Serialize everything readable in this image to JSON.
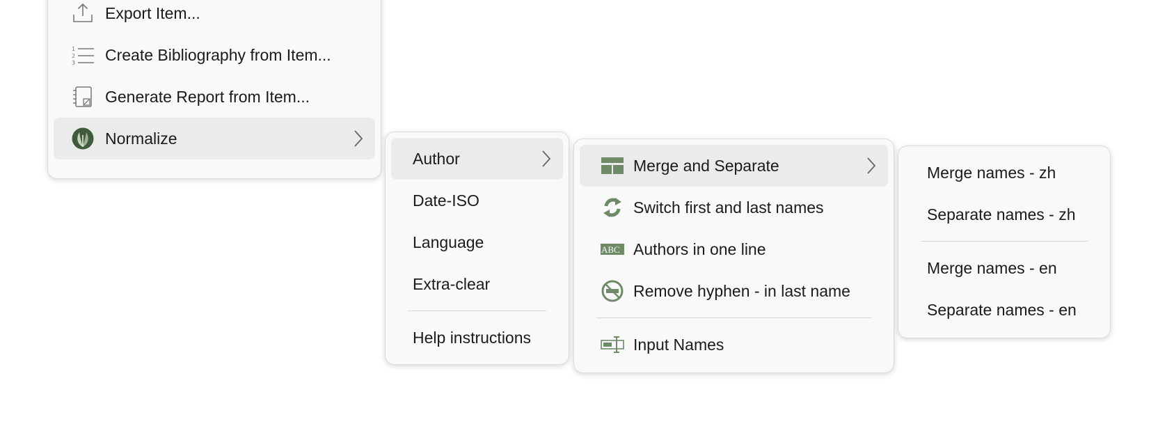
{
  "menu1": {
    "items": [
      {
        "label": "Export Item...",
        "icon": "export-icon"
      },
      {
        "label": "Create Bibliography from Item...",
        "icon": "numbered-list-icon"
      },
      {
        "label": "Generate Report from Item...",
        "icon": "report-icon"
      },
      {
        "label": "Normalize",
        "icon": "normalize-plugin-icon",
        "submenu": true
      }
    ]
  },
  "menu2": {
    "items": [
      {
        "label": "Author",
        "submenu": true
      },
      {
        "label": "Date-ISO"
      },
      {
        "label": "Language"
      },
      {
        "label": "Extra-clear"
      },
      {
        "label": "Help instructions"
      }
    ]
  },
  "menu3": {
    "items": [
      {
        "label": "Merge and Separate",
        "icon": "merge-separate-icon",
        "submenu": true
      },
      {
        "label": "Switch first and last names",
        "icon": "switch-names-icon"
      },
      {
        "label": "Authors in one line",
        "icon": "abc-text-icon",
        "icon_text": "ABC"
      },
      {
        "label": "Remove hyphen - in last name",
        "icon": "remove-hyphen-icon"
      },
      {
        "label": "Input Names",
        "icon": "input-names-icon"
      }
    ]
  },
  "menu4": {
    "items": [
      {
        "label": "Merge names - zh"
      },
      {
        "label": "Separate names - zh"
      },
      {
        "label": "Merge names - en"
      },
      {
        "label": "Separate names - en"
      }
    ]
  },
  "colors": {
    "menu_bg": "#f9f9f9",
    "highlight_bg": "#ebebeb",
    "icon_green": "#6e8a66",
    "text": "#1b1b1b"
  }
}
